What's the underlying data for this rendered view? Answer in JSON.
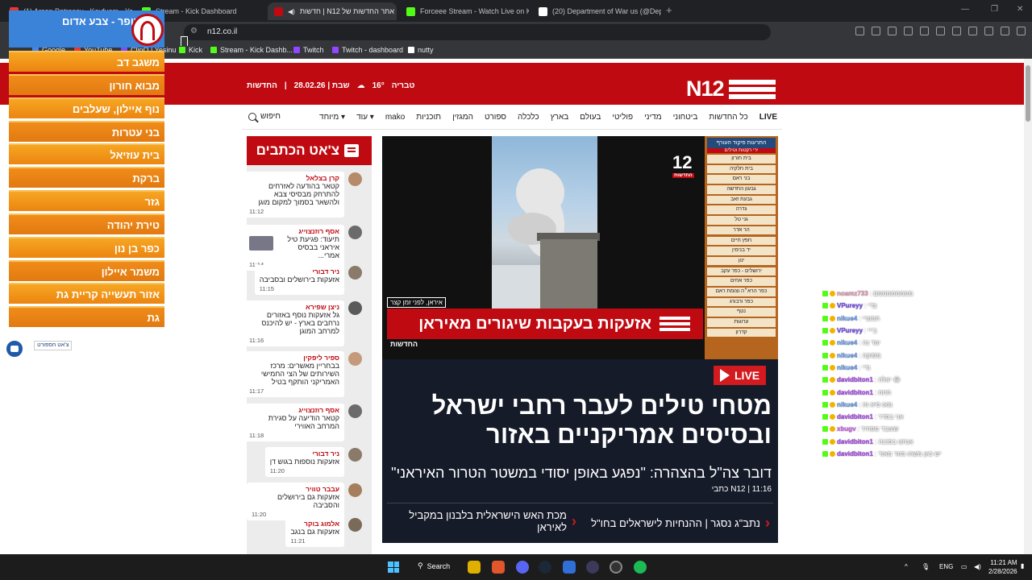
{
  "browser": {
    "tabs": [
      {
        "title": "(1) Arsen Petrosov - Kayfuem - YouT",
        "color": "#e53935",
        "active": false
      },
      {
        "title": "Stream - Kick Dashboard",
        "color": "#53fc18",
        "active": false
      },
      {
        "title": "חדשות | N12 אתר החדשות של",
        "color": "#c00a12",
        "active": true
      },
      {
        "title": "Forceee Stream - Watch Live on Kick",
        "color": "#53fc18",
        "active": false
      },
      {
        "title": "(20) Department of War us (@Deptof",
        "color": "#ffffff",
        "active": false
      }
    ],
    "new_tab": "+",
    "url": "n12.co.il",
    "bookmarks": [
      {
        "label": "Google",
        "color": "#4285f4"
      },
      {
        "label": "YouTube",
        "color": "#e53935"
      },
      {
        "label": "ClinQ | Yesinu",
        "color": "#7c4dff"
      },
      {
        "label": "Kick",
        "color": "#53fc18"
      },
      {
        "label": "Stream - Kick Dashb...",
        "color": "#53fc18"
      },
      {
        "label": "Twitch",
        "color": "#9146ff"
      },
      {
        "label": "Twitch - dashboard",
        "color": "#9146ff"
      },
      {
        "label": "nutty",
        "color": "#ffffff"
      }
    ]
  },
  "site": {
    "logo": "N12",
    "header_info": {
      "city": "טבריה",
      "temp": "16°",
      "date": "שבת | 28.02.26",
      "section": "החדשות"
    },
    "nav": [
      "LIVE",
      "כל החדשות",
      "ביטחוני",
      "מדיני",
      "פוליטי",
      "בעולם",
      "בארץ",
      "כלכלה",
      "ספורט",
      "המגזין",
      "תוכניות",
      "mako",
      "עוד ▾",
      "מיוחד ▾"
    ],
    "search_label": "חיפוש",
    "chat": {
      "title": "צ'אט הכתבים",
      "posts": [
        {
          "author": "קרן בצלאל",
          "text": "קטאר בהודעה לאזרחים להתרחק מבסיסי צבא ולהשאר בסמוך למקום מוגן",
          "time": "11:12"
        },
        {
          "author": "אסף רוזנצוייג",
          "text": "תיעוד: פגיעת טיל איראני בבסיס אמרי...",
          "time": "11:14"
        },
        {
          "author": "ניר דבורי",
          "text": "אזעקות בירושלים ובסביבה",
          "time": "11:15"
        },
        {
          "author": "ניצן שפירא",
          "text": "גל אזעקות נוסף באזורים נרחבים בארץ - יש להיכנס למרחב המוגן",
          "time": "11:16"
        },
        {
          "author": "ספיר ליפקין",
          "text": "בבחריין מאשרים: מרכז השירותים של הצי החמישי האמריקני הותקף בטיל",
          "time": "11:17"
        },
        {
          "author": "אסף רוזנצוייג",
          "text": "קטאר הודיעה על סגירת המרחב האווירי",
          "time": "11:18"
        },
        {
          "author": "ניר דבורי",
          "text": "אזעקות נוספות בגוש דן",
          "time": "11:20"
        },
        {
          "author": "עבבר טוויר",
          "text": "אזעקות גם בירושלים והסביבה",
          "time": "11:20"
        },
        {
          "author": "אלמוג בוקר",
          "text": "אזעקות גם בנגב",
          "time": "11:21"
        }
      ]
    },
    "video": {
      "channel": "12",
      "channel_sub": "החדשות",
      "source_caption": "איראן, לפני זמן קצר",
      "banner": "אזעקות בעקבות שיגורים מאיראן",
      "brand": "החדשות",
      "alerts_title": "התרעות פיקוד העורף",
      "alerts_sub": "ירי רקטות וטילים",
      "alerts": [
        "בית חורון",
        "בית חלקיה",
        "בני ראם",
        "גבעון החדשה",
        "גבעת זאב",
        "גדרה",
        "גני טל",
        "הר אדר",
        "חפץ חיים",
        "יד בנימין",
        "ינון",
        "ירושלים - כפר עקב",
        "כפר אחים",
        "כפר הרא״ה וצומת ראם",
        "כפר ורבורג",
        "נטף",
        "ערוגות",
        "קדרון"
      ]
    },
    "story": {
      "live_label": "LIVE",
      "headline": "מטחי טילים לעבר רחבי ישראל ובסיסים אמריקניים באזור",
      "subline": "דובר צה\"ל בהצהרה: \"נפגע באופן יסודי במשטר הטרור האיראני\"",
      "byline": "כתבי N12 | 11:16",
      "related": [
        "נתב\"ג נסגר | ההנחיות לישראלים בחו\"ל",
        "מכת האש הישראלית בלבנון במקביל לאיראן"
      ]
    }
  },
  "tzofar": {
    "title": "צופר - צבע אדום",
    "items": [
      "משגב דב",
      "מבוא חורון",
      "נוף איילון, שעלבים",
      "בני עטרות",
      "בית עוזיאל",
      "ברקת",
      "גזר",
      "טירת יהודה",
      "כפר בן נון",
      "משמר איילון",
      "אזור תעשייה קריית גת",
      "גת"
    ],
    "fab_label": "צ'אט הספורט"
  },
  "kick_chat": [
    {
      "user": "noamz733",
      "color": "#f4a7c1",
      "msg": ": ממממממממם"
    },
    {
      "user": "VPureyy",
      "color": "#7b4dff",
      "msg": ": צדי"
    },
    {
      "user": "nikue4",
      "color": "#6ea7ff",
      "msg": ": חמוציי"
    },
    {
      "user": "VPureyy",
      "color": "#7b4dff",
      "msg": ": בייי"
    },
    {
      "user": "nikue4",
      "color": "#6ea7ff",
      "msg": ": עוד נה"
    },
    {
      "user": "nikue4",
      "color": "#6ea7ff",
      "msg": ": מסוקה"
    },
    {
      "user": "nikue4",
      "color": "#6ea7ff",
      "msg": ": נדי"
    },
    {
      "user": "davidbiton1",
      "color": "#b64cff",
      "msg": ": יאלה 😂"
    },
    {
      "user": "davidbiton1",
      "color": "#b64cff",
      "msg": ": חחח"
    },
    {
      "user": "nikue4",
      "color": "#6ea7ff",
      "msg": ": מאו סיא זה"
    },
    {
      "user": "davidbiton1",
      "color": "#b64cff",
      "msg": ": אני בסדר"
    },
    {
      "user": "xbugv",
      "color": "#e06aff",
      "msg": ": שעובד מפחיד"
    },
    {
      "user": "davidbiton1",
      "color": "#b64cff",
      "msg": ": אנחנו בסכנה"
    },
    {
      "user": "davidbiton1",
      "color": "#b64cff",
      "msg": ": יש כאן משהו מוזר מאוד"
    }
  ],
  "taskbar": {
    "search_label": "Search",
    "lang": "ENG",
    "time": "11:21 AM",
    "date": "2/28/2026"
  }
}
